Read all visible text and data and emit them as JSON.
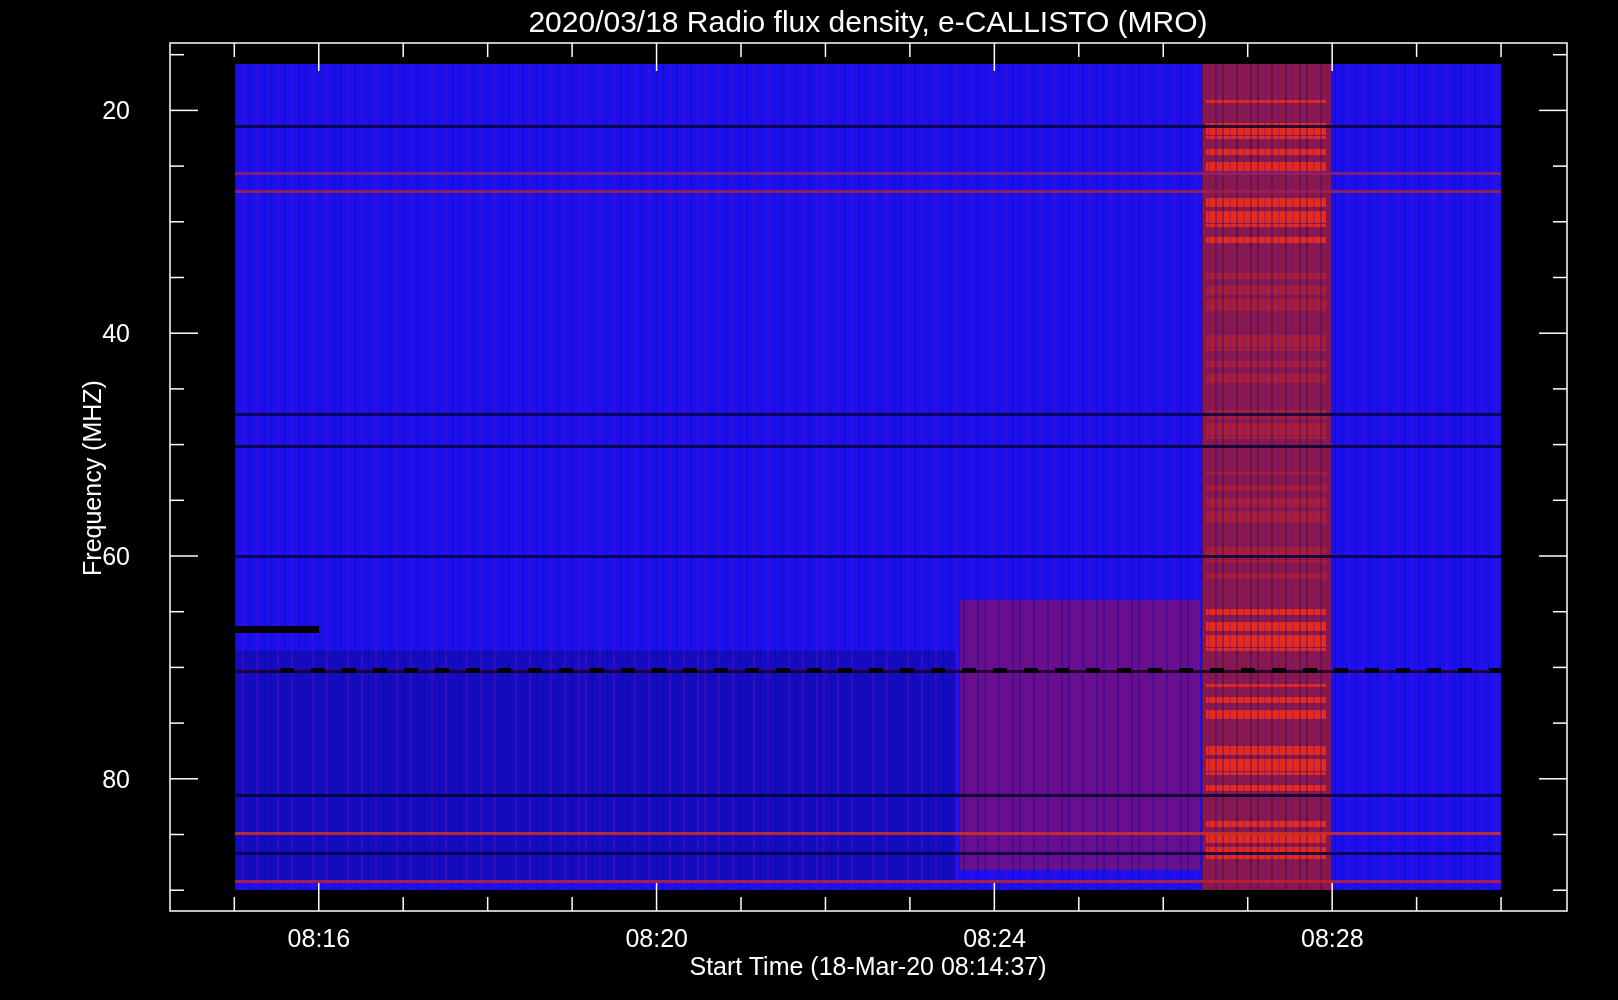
{
  "title": "2020/03/18  Radio flux density, e-CALLISTO (MRO)",
  "y_axis": {
    "label": "Frequency (MHZ)",
    "ticks": [
      "20",
      "40",
      "60",
      "80"
    ]
  },
  "x_axis": {
    "label": "Start Time (18-Mar-20 08:14:37)",
    "ticks": [
      "08:16",
      "08:20",
      "08:24",
      "08:28"
    ]
  }
}
